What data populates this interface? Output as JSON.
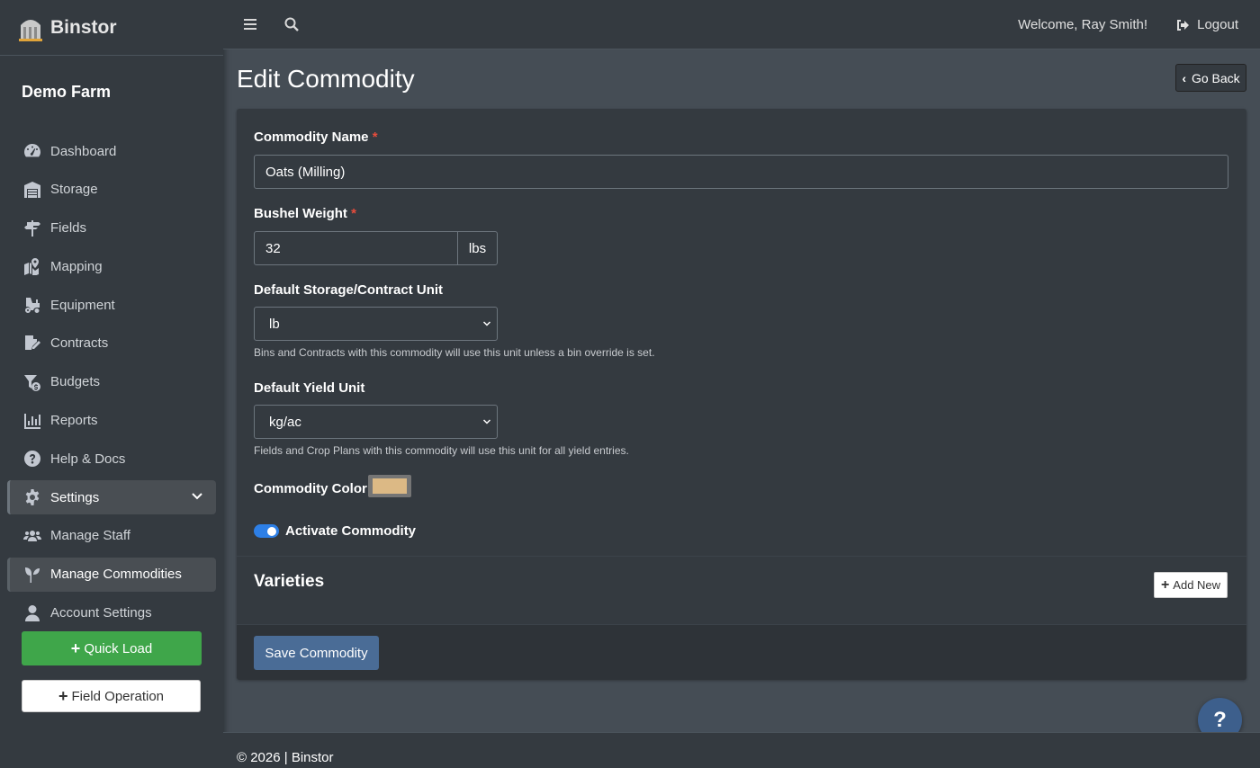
{
  "brand": {
    "name": "Binstor"
  },
  "sidebar": {
    "farm_name": "Demo Farm",
    "items": [
      {
        "label": "Dashboard",
        "icon": "dashboard-gauge-icon"
      },
      {
        "label": "Storage",
        "icon": "warehouse-icon"
      },
      {
        "label": "Fields",
        "icon": "signpost-icon"
      },
      {
        "label": "Mapping",
        "icon": "map-marker-icon"
      },
      {
        "label": "Equipment",
        "icon": "tractor-icon"
      },
      {
        "label": "Contracts",
        "icon": "file-signature-icon"
      },
      {
        "label": "Budgets",
        "icon": "funnel-dollar-icon"
      },
      {
        "label": "Reports",
        "icon": "bar-chart-icon"
      },
      {
        "label": "Help & Docs",
        "icon": "question-circle-icon"
      },
      {
        "label": "Settings",
        "icon": "gear-icon"
      },
      {
        "label": "Manage Staff",
        "icon": "users-icon"
      },
      {
        "label": "Manage Commodities",
        "icon": "seedling-icon"
      },
      {
        "label": "Account Settings",
        "icon": "user-icon"
      }
    ],
    "quick_load": "Quick Load",
    "field_operation": "Field Operation"
  },
  "topbar": {
    "welcome": "Welcome, Ray Smith!",
    "logout": "Logout"
  },
  "page": {
    "title": "Edit Commodity",
    "go_back": "Go Back"
  },
  "form": {
    "name_label": "Commodity Name",
    "name_value": "Oats (Milling)",
    "required_mark": "*",
    "bushel_label": "Bushel Weight",
    "bushel_value": "32",
    "bushel_unit": "lbs",
    "storage_unit_label": "Default Storage/Contract Unit",
    "storage_unit_value": "lb",
    "storage_unit_help": "Bins and Contracts with this commodity will use this unit unless a bin override is set.",
    "yield_unit_label": "Default Yield Unit",
    "yield_unit_value": "kg/ac",
    "yield_unit_help": "Fields and Crop Plans with this commodity will use this unit for all yield entries.",
    "color_label": "Commodity Color",
    "color_value": "#dcb985",
    "activate_label": "Activate Commodity",
    "activate_on": true,
    "varieties_title": "Varieties",
    "add_new": "Add New",
    "save": "Save Commodity"
  },
  "help_bubble": "?",
  "footer": {
    "text": "© 2026 | Binstor"
  },
  "colors": {
    "sidebar_bg": "#343a40",
    "content_bg": "#454d55",
    "quick_load_green": "#3fa64a",
    "save_blue": "#4a6c96",
    "toggle_blue": "#2d7fe6"
  }
}
